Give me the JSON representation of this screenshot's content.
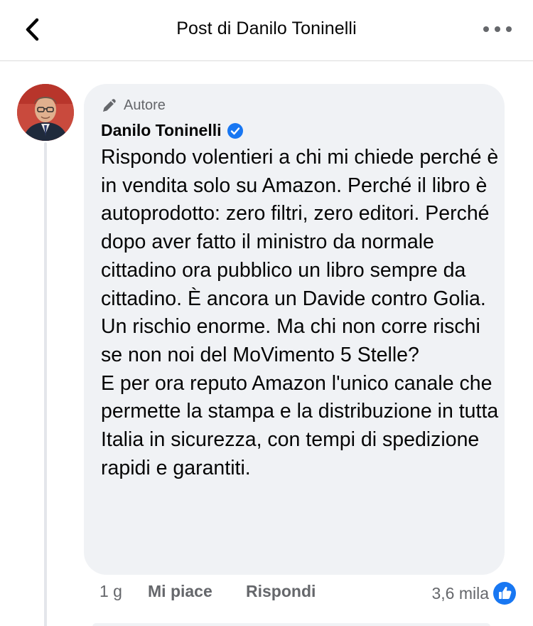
{
  "header": {
    "title": "Post di Danilo Toninelli",
    "back_icon": "chevron-left-icon",
    "more_icon": "more-horizontal-icon"
  },
  "comment": {
    "badge_label": "Autore",
    "badge_icon": "pencil-icon",
    "author_name": "Danilo Toninelli",
    "verified_icon": "verified-badge-icon",
    "text": "Rispondo volentieri a chi mi chiede perché è in vendita solo su Amazon. Perché il libro è autoprodotto: zero filtri, zero editori. Perché dopo aver fatto il ministro da normale cittadino ora pubblico un libro sempre da cittadino. È ancora un Davide contro Golia. Un rischio enorme. Ma chi non corre rischi se non noi del MoVimento 5 Stelle?\nE per ora reputo Amazon l'unico canale che permette la stampa e la distribuzione in tutta Italia in sicurezza, con tempi di spedizione rapidi e garantiti."
  },
  "actions": {
    "time": "1 g",
    "like_label": "Mi piace",
    "reply_label": "Rispondi",
    "reaction_count": "3,6 mila",
    "reaction_icon": "like-thumb-icon"
  },
  "colors": {
    "accent": "#1877f2",
    "bubble": "#f0f2f5",
    "secondary_text": "#65676b"
  }
}
